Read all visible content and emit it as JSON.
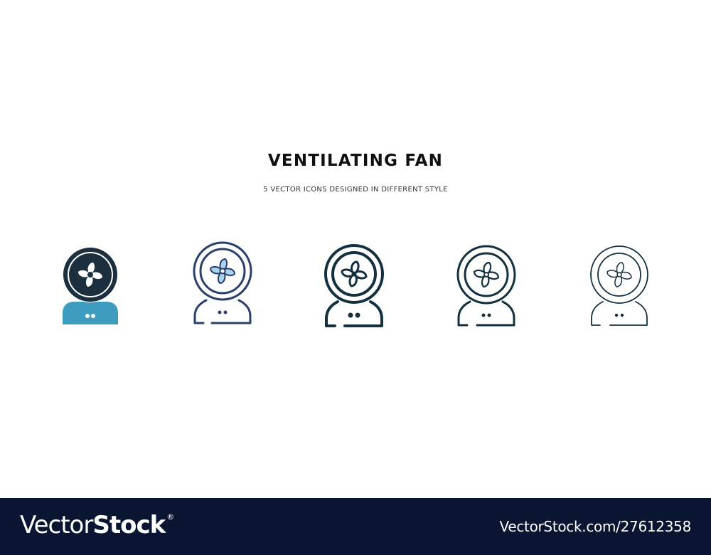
{
  "heading": {
    "title": "VENTILATING FAN",
    "subtitle": "5 VECTOR ICONS DESIGNED IN DIFFERENT STYLE"
  },
  "icons": [
    {
      "style": "glyph-two-tone",
      "name": "ventilating-fan-icon"
    },
    {
      "style": "filled-outline-blue",
      "name": "ventilating-fan-icon"
    },
    {
      "style": "bold-outline",
      "name": "ventilating-fan-icon"
    },
    {
      "style": "medium-outline",
      "name": "ventilating-fan-icon"
    },
    {
      "style": "thin-outline",
      "name": "ventilating-fan-icon"
    }
  ],
  "colors": {
    "dark": "#1b2f3f",
    "teal": "#3e9dbf",
    "navy": "#2b3f6a",
    "light_blue": "#a9d3f2",
    "footer_bg": "#0a1532"
  },
  "footer": {
    "logo_light": "Vector",
    "logo_bold": "Stock",
    "logo_mark": "®",
    "credit": "VectorStock.com/27612358"
  }
}
